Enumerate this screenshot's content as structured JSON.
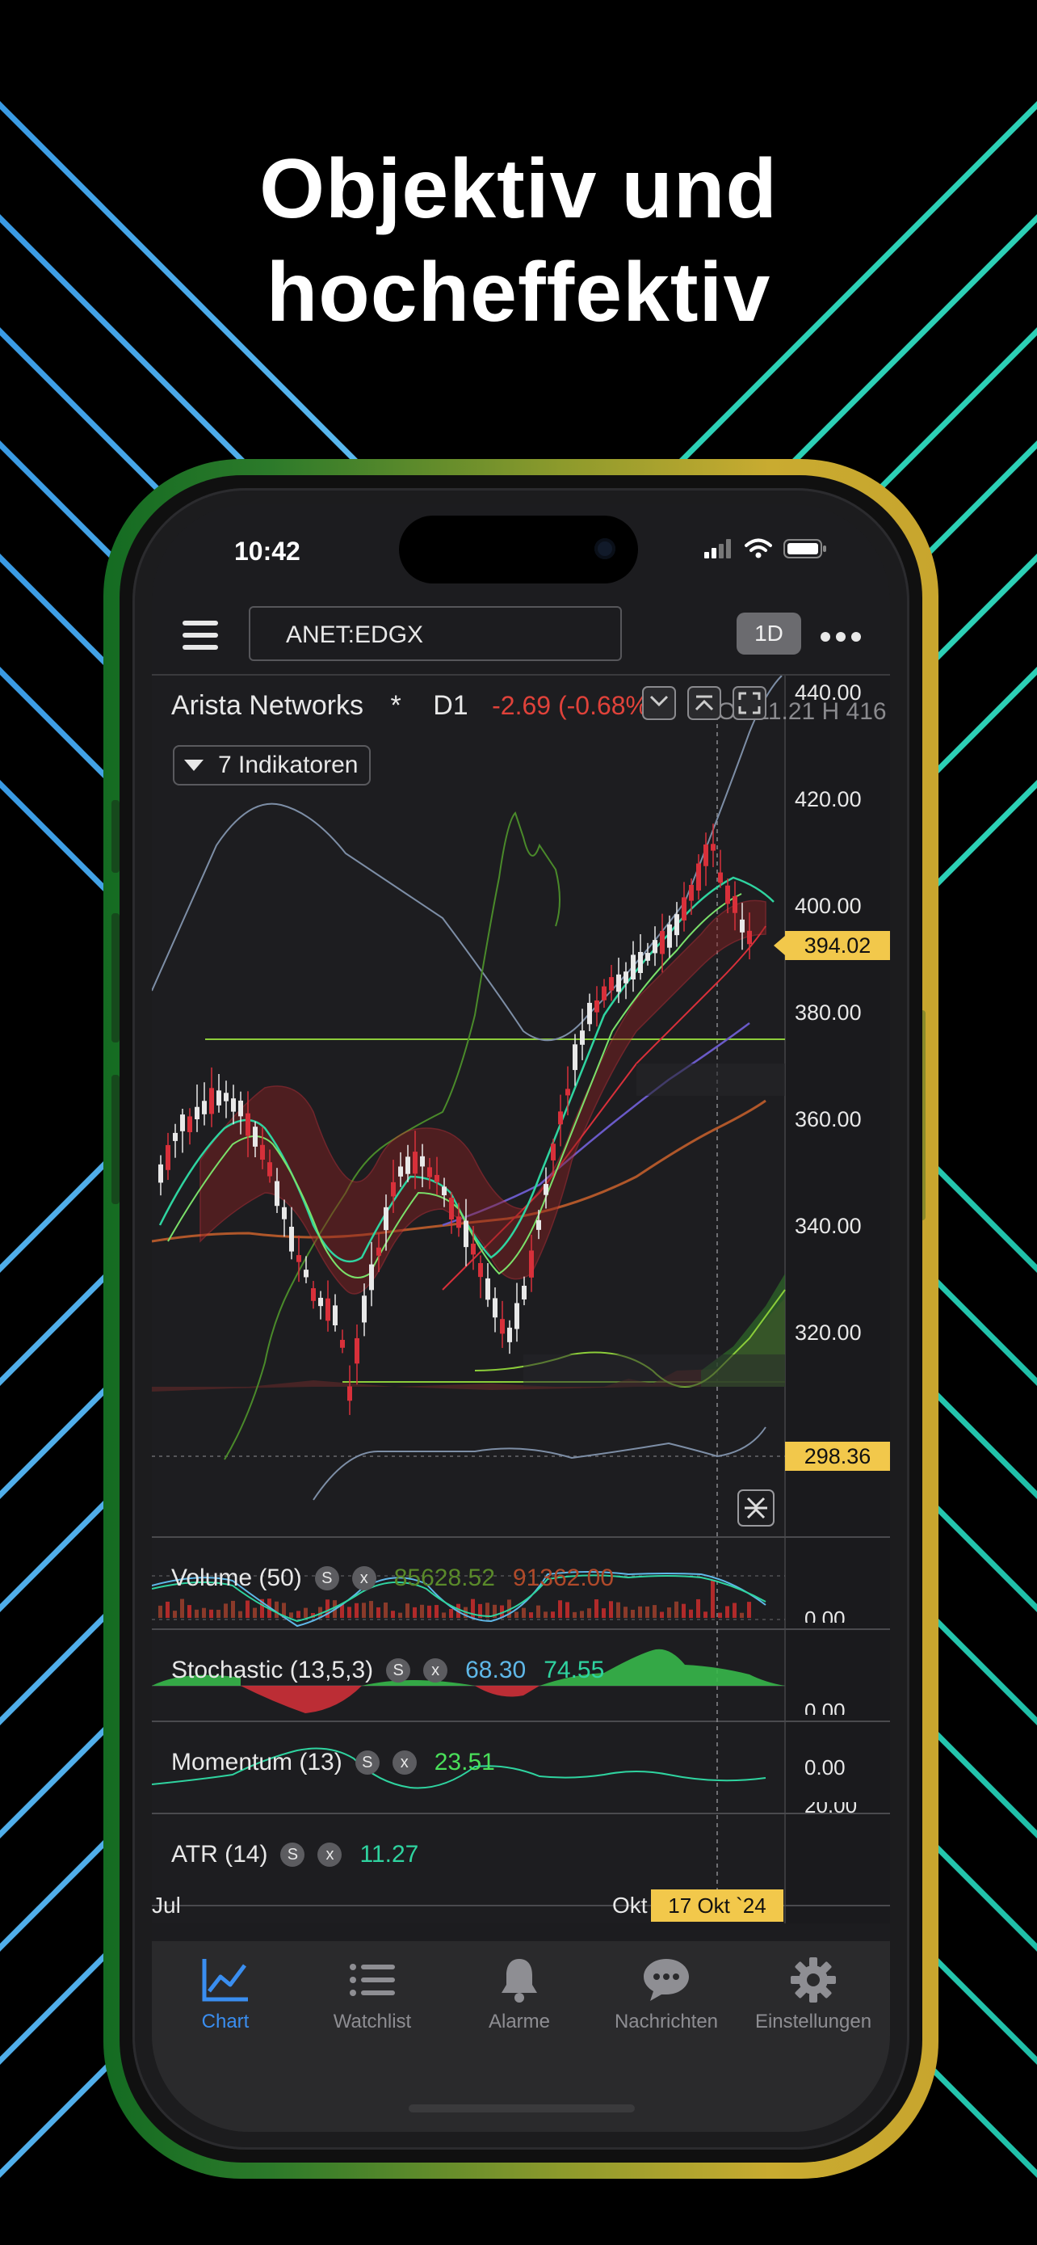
{
  "headline": {
    "line1": "Objektiv und",
    "line2": "hocheffektiv"
  },
  "status_bar": {
    "time": "10:42"
  },
  "topbar": {
    "ticker": "ANET:EDGX",
    "timeframe": "1D"
  },
  "chart": {
    "instrument": "Arista Networks",
    "marker": "*",
    "interval": "D1",
    "change": "-2.69 (-0.68%)",
    "ohl_text": "O 411.21  H 416",
    "indicators_button": "7 Indikatoren",
    "price_axis": [
      "440.00",
      "420.00",
      "400.00",
      "380.00",
      "360.00",
      "340.00",
      "320.00"
    ],
    "current_price": "394.02",
    "support_price": "298.36",
    "panes": {
      "volume": {
        "label": "Volume (50)",
        "v1": "85628.52",
        "v2": "91362.00",
        "axis": "0.00"
      },
      "stochastic": {
        "label": "Stochastic (13,5,3)",
        "v1": "68.30",
        "v2": "74.55",
        "axis": "0.00"
      },
      "momentum": {
        "label": "Momentum (13)",
        "v1": "23.51",
        "axis": "0.00"
      },
      "atr": {
        "label": "ATR (14)",
        "v1": "11.27",
        "axis": "20.00"
      }
    },
    "x_axis": {
      "left": "Jul",
      "mid": "Okt",
      "cursor_date": "17 Okt `24"
    },
    "colors": {
      "up": "#e8e8e8",
      "down": "#d8303a",
      "accent_yellow": "#f2c84b",
      "green_line": "#8ccd3a"
    }
  },
  "tabbar": {
    "items": [
      {
        "label": "Chart",
        "icon": "chart-line-icon"
      },
      {
        "label": "Watchlist",
        "icon": "list-icon"
      },
      {
        "label": "Alarme",
        "icon": "bell-icon"
      },
      {
        "label": "Nachrichten",
        "icon": "speech-bubble-icon"
      },
      {
        "label": "Einstellungen",
        "icon": "gear-icon"
      }
    ],
    "active_color": "#3a8ef0"
  }
}
